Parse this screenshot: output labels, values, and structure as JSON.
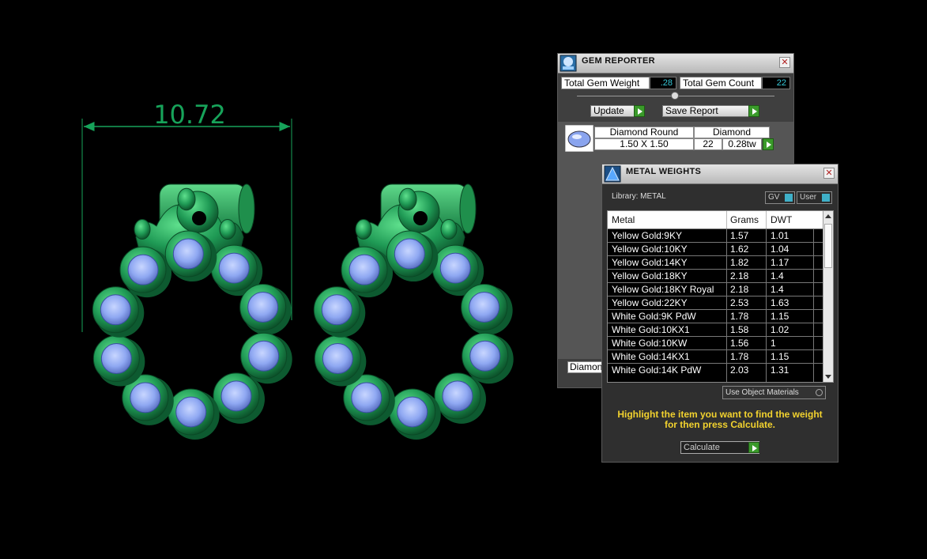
{
  "viewport": {
    "dimension_label": "10.72",
    "colors": {
      "metal": "#1f9a55",
      "metal_dark": "#0e5f32",
      "gem": "#8fa8f2",
      "dimension": "#17a35a"
    }
  },
  "gem_reporter": {
    "title": "GEM REPORTER",
    "total_gem_weight_label": "Total Gem Weight",
    "total_gem_weight_value": ".28",
    "total_gem_count_label": "Total Gem Count",
    "total_gem_count_value": "22",
    "update_label": "Update",
    "save_report_label": "Save Report",
    "gem": {
      "shape": "Diamond Round",
      "material": "Diamond",
      "size": "1.50 X 1.50",
      "count": "22",
      "weight": "0.28tw"
    },
    "footer_partial": "Diamond"
  },
  "metal_weights": {
    "title": "METAL WEIGHTS",
    "library_label": "Library: METAL",
    "gv_label": "GV",
    "user_label": "User",
    "columns": [
      "Metal",
      "Grams",
      "DWT"
    ],
    "rows": [
      [
        "Yellow Gold:9KY",
        "1.57",
        "1.01"
      ],
      [
        "Yellow Gold:10KY",
        "1.62",
        "1.04"
      ],
      [
        "Yellow Gold:14KY",
        "1.82",
        "1.17"
      ],
      [
        "Yellow Gold:18KY",
        "2.18",
        "1.4"
      ],
      [
        "Yellow Gold:18KY Royal",
        "2.18",
        "1.4"
      ],
      [
        "Yellow Gold:22KY",
        "2.53",
        "1.63"
      ],
      [
        "White Gold:9K PdW",
        "1.78",
        "1.15"
      ],
      [
        "White Gold:10KX1",
        "1.58",
        "1.02"
      ],
      [
        "White Gold:10KW",
        "1.56",
        "1"
      ],
      [
        "White Gold:14KX1",
        "1.78",
        "1.15"
      ],
      [
        "White Gold:14K PdW",
        "2.03",
        "1.31"
      ]
    ],
    "use_object_materials_label": "Use Object Materials",
    "hint_line1": "Highlight the item you want to find the weight",
    "hint_line2": "for then press Calculate.",
    "calculate_label": "Calculate"
  }
}
